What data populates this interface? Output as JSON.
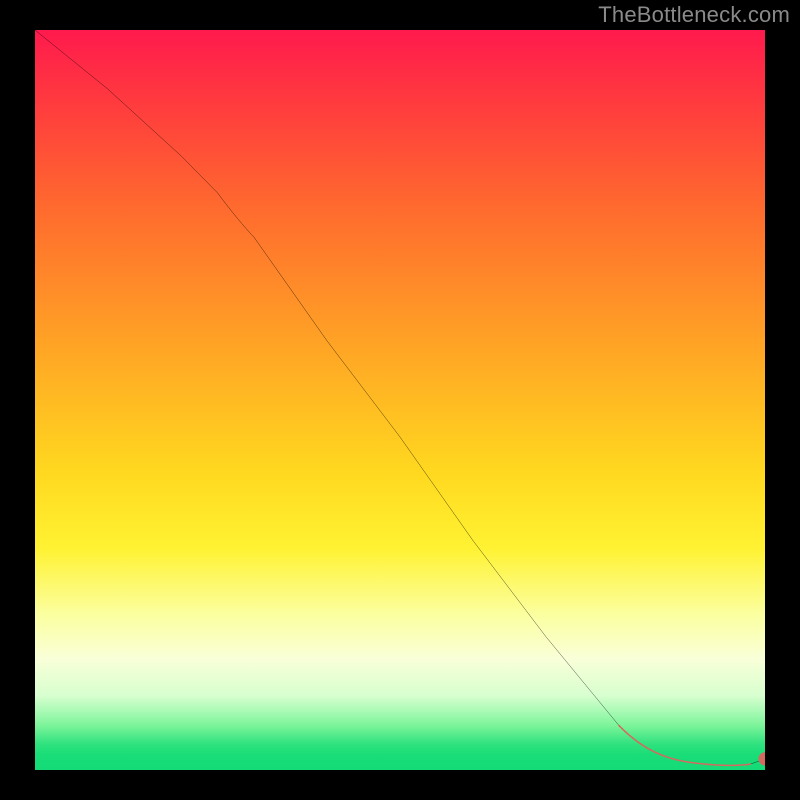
{
  "watermark": "TheBottleneck.com",
  "chart_data": {
    "type": "line",
    "title": "",
    "xlabel": "",
    "ylabel": "",
    "xlim": [
      0,
      100
    ],
    "ylim": [
      0,
      100
    ],
    "series": [
      {
        "name": "main-curve",
        "x": [
          0,
          10,
          20,
          25,
          30,
          40,
          50,
          60,
          70,
          80,
          85,
          90,
          95,
          100
        ],
        "values": [
          100,
          92,
          83,
          78,
          72,
          58,
          45,
          31,
          18,
          6,
          2,
          1,
          0.5,
          1.5
        ]
      }
    ],
    "markers": {
      "name": "highlight-segment",
      "color": "#d46a5f",
      "x": [
        80,
        82,
        84,
        86,
        88,
        90,
        92,
        94,
        96,
        98,
        100
      ],
      "values": [
        6,
        4.5,
        3,
        2,
        1.3,
        1,
        0.8,
        0.6,
        0.5,
        0.8,
        1.5
      ]
    },
    "gradient_stops": [
      {
        "pos": 0.0,
        "color": "#ff1a4d"
      },
      {
        "pos": 0.24,
        "color": "#ff6a2e"
      },
      {
        "pos": 0.6,
        "color": "#ffd91f"
      },
      {
        "pos": 0.85,
        "color": "#f9ffd8"
      },
      {
        "pos": 0.96,
        "color": "#2fe27e"
      },
      {
        "pos": 1.0,
        "color": "#14db77"
      }
    ]
  }
}
